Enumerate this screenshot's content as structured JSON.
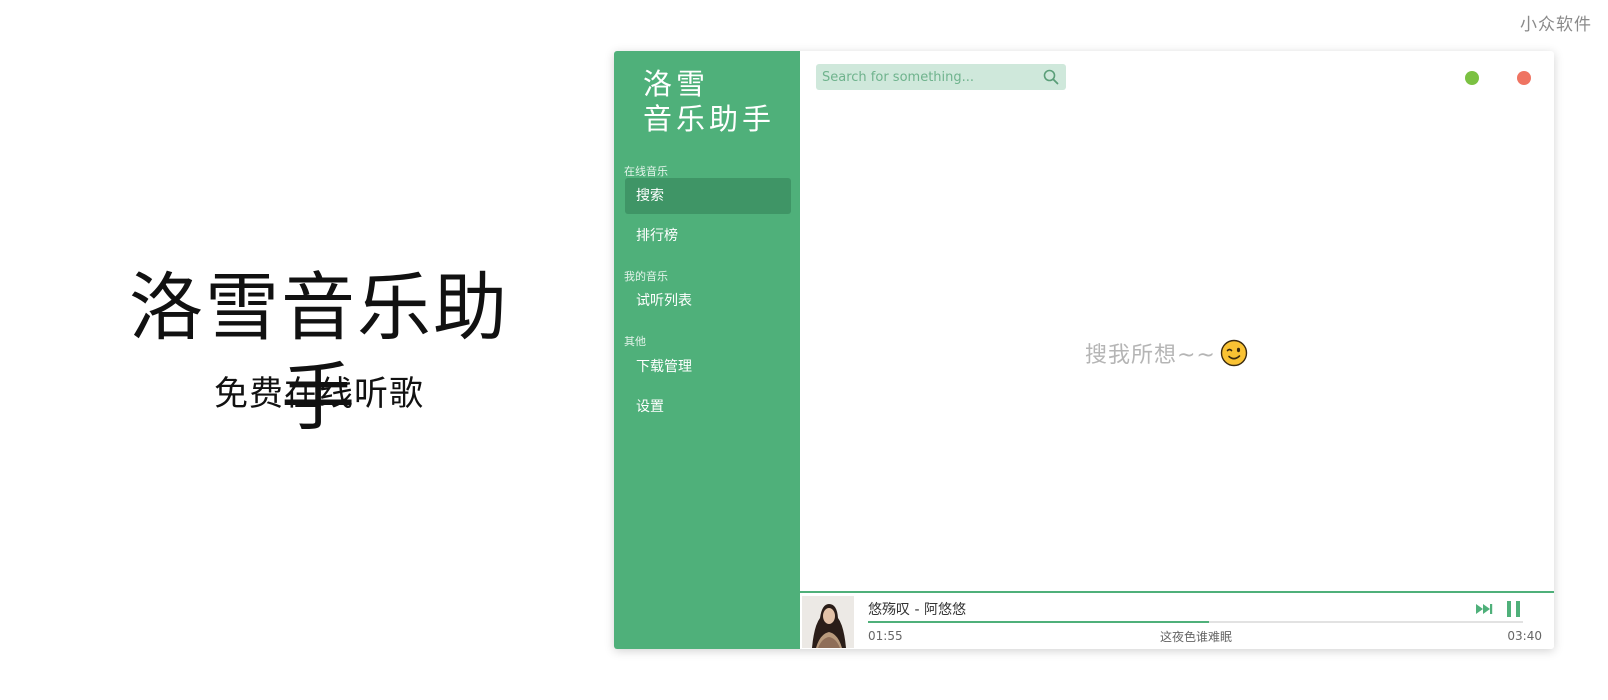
{
  "watermark": "小众软件",
  "promo": {
    "title": "洛雪音乐助手",
    "subtitle": "免费在线听歌"
  },
  "app": {
    "logo_line1": "洛雪",
    "logo_line2": "音乐助手",
    "sections": [
      {
        "label": "在线音乐",
        "items": [
          {
            "label": "搜索",
            "active": true
          },
          {
            "label": "排行榜",
            "active": false
          }
        ]
      },
      {
        "label": "我的音乐",
        "items": [
          {
            "label": "试听列表",
            "active": false
          }
        ]
      },
      {
        "label": "其他",
        "items": [
          {
            "label": "下载管理",
            "active": false
          },
          {
            "label": "设置",
            "active": false
          }
        ]
      }
    ],
    "search": {
      "placeholder": "Search for something..."
    },
    "empty_state": "搜我所想~~",
    "player": {
      "song": "悠殇叹 - 阿悠悠",
      "current_time": "01:55",
      "total_time": "03:40",
      "lyric": "这夜色谁难眠",
      "progress": 0.52
    },
    "colors": {
      "accent": "#4fb07a",
      "active_item": "#3f9566",
      "minimize": "#7bc142",
      "close": "#ef7462"
    }
  }
}
